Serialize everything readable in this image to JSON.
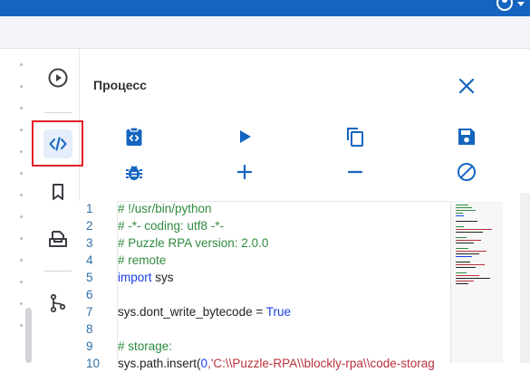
{
  "header": {
    "color": "#1565c0",
    "avatar_icon": "account-circle-icon"
  },
  "icon_bar": {
    "items": [
      {
        "name": "play-circle-icon",
        "selected": false
      },
      {
        "name": "code-icon",
        "selected": true
      },
      {
        "name": "bookmark-icon",
        "selected": false
      },
      {
        "name": "inbox-stack-icon",
        "selected": false
      },
      {
        "name": "branch-fork-icon",
        "selected": false
      }
    ],
    "highlight_color": "#e41e26"
  },
  "panel": {
    "title": "Процесс",
    "close_icon": "close-icon",
    "accent_color": "#1565c0",
    "toolbar_row1": [
      "clipboard-code-icon",
      "play-icon",
      "copy-icon",
      "save-icon"
    ],
    "toolbar_row2": [
      "bug-icon",
      "plus-icon",
      "minus-icon",
      "block-icon"
    ]
  },
  "editor": {
    "lines": [
      {
        "n": "1",
        "tokens": [
          {
            "t": "# !/usr/bin/python",
            "c": "comment"
          }
        ]
      },
      {
        "n": "2",
        "tokens": [
          {
            "t": "# -*- coding: utf8 -*-",
            "c": "comment"
          }
        ]
      },
      {
        "n": "3",
        "tokens": [
          {
            "t": "# Puzzle RPA version: 2.0.0",
            "c": "comment"
          }
        ]
      },
      {
        "n": "4",
        "tokens": [
          {
            "t": "# remote",
            "c": "comment"
          }
        ]
      },
      {
        "n": "5",
        "tokens": [
          {
            "t": "import",
            "c": "kw"
          },
          {
            "t": " sys",
            "c": "plain"
          }
        ]
      },
      {
        "n": "6",
        "tokens": []
      },
      {
        "n": "7",
        "tokens": [
          {
            "t": "sys.dont_write_bytecode = ",
            "c": "plain"
          },
          {
            "t": "True",
            "c": "kw"
          }
        ]
      },
      {
        "n": "8",
        "tokens": []
      },
      {
        "n": "9",
        "tokens": [
          {
            "t": "# storage:",
            "c": "comment"
          }
        ]
      },
      {
        "n": "10",
        "tokens": [
          {
            "t": "sys.path.insert(",
            "c": "plain"
          },
          {
            "t": "0",
            "c": "kw"
          },
          {
            "t": ",'C:\\\\Puzzle-RPA\\\\blockly-rpa\\\\code-storag",
            "c": "str"
          }
        ]
      }
    ]
  }
}
